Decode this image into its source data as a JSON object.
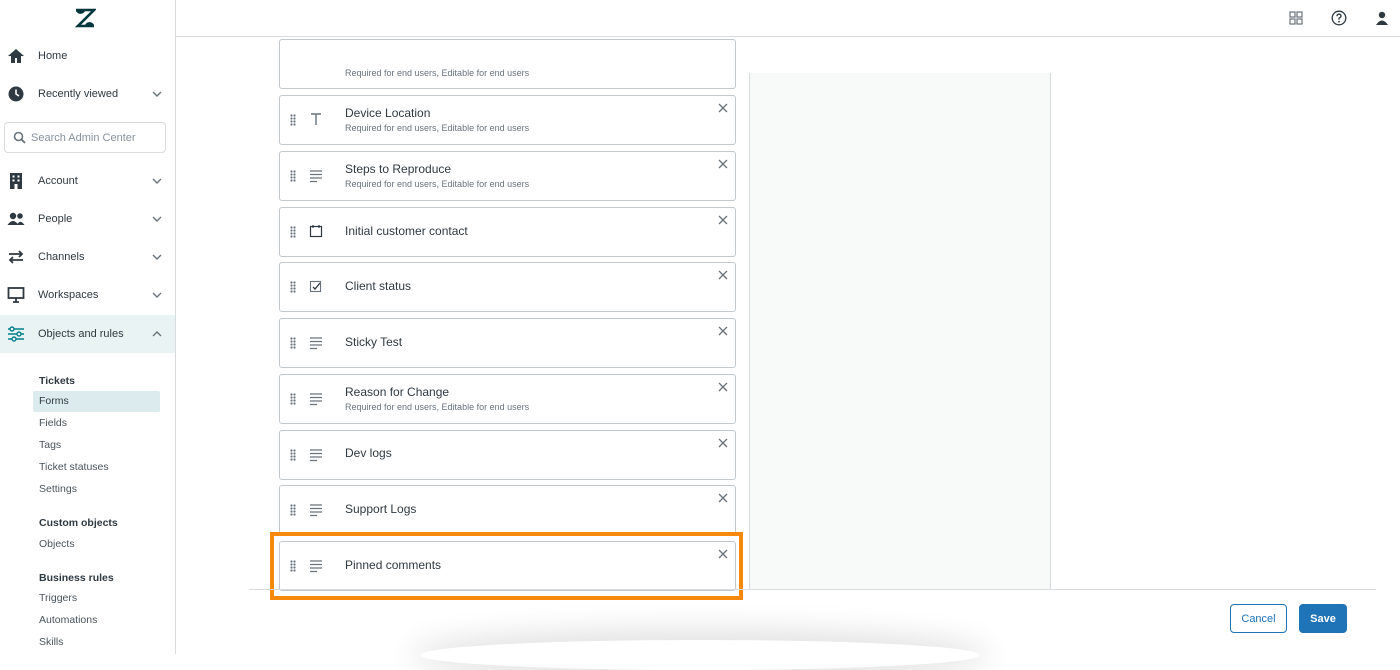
{
  "sidebar": {
    "nav": [
      {
        "label": "Home",
        "icon": "home-icon"
      },
      {
        "label": "Recently viewed",
        "icon": "clock-icon"
      },
      {
        "label": "Account",
        "icon": "building-icon"
      },
      {
        "label": "People",
        "icon": "people-icon"
      },
      {
        "label": "Channels",
        "icon": "arrows-icon"
      },
      {
        "label": "Workspaces",
        "icon": "monitor-icon"
      },
      {
        "label": "Objects and rules",
        "icon": "objects-rules-icon"
      }
    ],
    "search_placeholder": "Search Admin Center",
    "sections": [
      {
        "heading": "Tickets",
        "items": [
          "Forms",
          "Fields",
          "Tags",
          "Ticket statuses",
          "Settings"
        ]
      },
      {
        "heading": "Custom objects",
        "items": [
          "Objects"
        ]
      },
      {
        "heading": "Business rules",
        "items": [
          "Triggers",
          "Automations",
          "Skills"
        ]
      }
    ]
  },
  "fields": [
    {
      "name": "",
      "sub": "Required for end users, Editable for end users",
      "icon": "text-icon"
    },
    {
      "name": "Device Location",
      "sub": "Required for end users, Editable for end users",
      "icon": "text-icon"
    },
    {
      "name": "Steps to Reproduce",
      "sub": "Required for end users, Editable for end users",
      "icon": "multiline-icon"
    },
    {
      "name": "Initial customer contact",
      "sub": "",
      "icon": "calendar-icon"
    },
    {
      "name": "Client status",
      "sub": "",
      "icon": "dropdown-icon"
    },
    {
      "name": "Sticky Test",
      "sub": "",
      "icon": "multiline-icon"
    },
    {
      "name": "Reason for Change",
      "sub": "Required for end users, Editable for end users",
      "icon": "multiline-icon"
    },
    {
      "name": "Dev logs",
      "sub": "",
      "icon": "multiline-icon"
    },
    {
      "name": "Support Logs",
      "sub": "",
      "icon": "multiline-icon"
    },
    {
      "name": "Pinned comments",
      "sub": "",
      "icon": "multiline-icon"
    }
  ],
  "footer": {
    "cancel_label": "Cancel",
    "save_label": "Save"
  },
  "colors": {
    "accent": "#1f73b7",
    "highlight": "#f6890b",
    "active_nav": "#e9f3f3"
  }
}
